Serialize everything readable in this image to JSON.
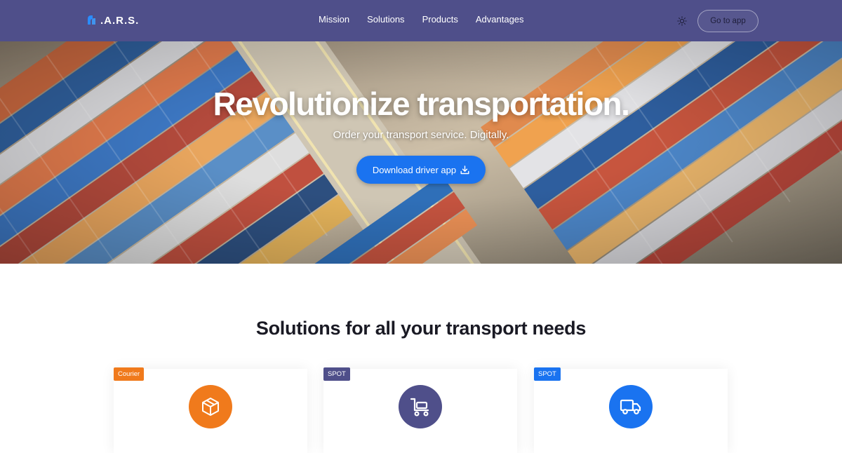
{
  "nav": {
    "logo_text": ".A.R.S.",
    "links": [
      "Mission",
      "Solutions",
      "Products",
      "Advantages"
    ],
    "cta_label": "Go to app",
    "theme_icon": "sun-icon"
  },
  "hero": {
    "title": "Revolutionize transportation.",
    "subtitle": "Order your transport service. Digitally.",
    "button_label": "Download driver app",
    "button_icon": "download-icon",
    "background": "aerial container port"
  },
  "solutions": {
    "title": "Solutions for all your transport needs",
    "cards": [
      {
        "badge": "Courier",
        "badge_color": "#f07a1c",
        "icon": "package-icon",
        "icon_color": "#f07a1c"
      },
      {
        "badge": "SPOT",
        "badge_color": "#4f4f8a",
        "icon": "cart-icon",
        "icon_color": "#4f4f8a"
      },
      {
        "badge": "SPOT",
        "badge_color": "#1a73f0",
        "icon": "truck-icon",
        "icon_color": "#1a73f0"
      }
    ]
  },
  "colors": {
    "nav_bg": "#4f4f8a",
    "primary": "#1a73f0",
    "accent": "#f07a1c"
  }
}
